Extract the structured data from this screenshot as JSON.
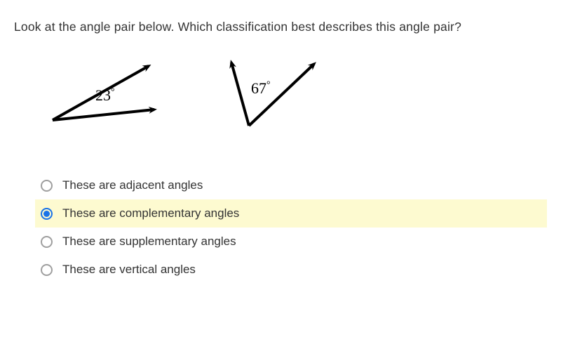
{
  "question": "Look at the angle pair below.  Which classification best describes this angle pair?",
  "figure": {
    "angle1_label": "23",
    "angle2_label": "67",
    "degree_symbol": "°"
  },
  "options": [
    {
      "label": "These are adjacent angles",
      "selected": false
    },
    {
      "label": "These are complementary angles",
      "selected": true
    },
    {
      "label": "These are supplementary angles",
      "selected": false
    },
    {
      "label": "These are vertical angles",
      "selected": false
    }
  ]
}
